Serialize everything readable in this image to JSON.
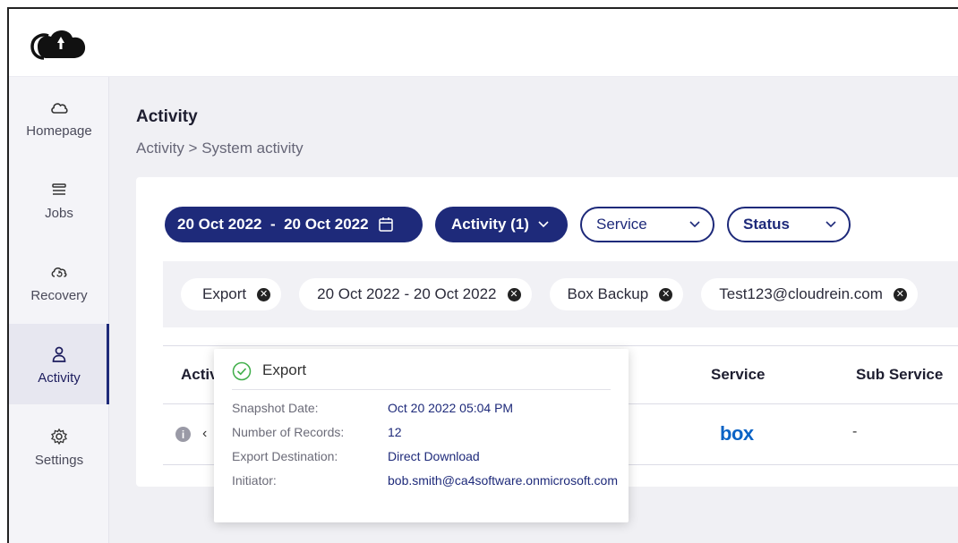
{
  "sidebar": {
    "items": [
      {
        "label": "Homepage",
        "icon": "cloud-icon"
      },
      {
        "label": "Jobs",
        "icon": "list-icon"
      },
      {
        "label": "Recovery",
        "icon": "recovery-icon"
      },
      {
        "label": "Activity",
        "icon": "user-icon"
      },
      {
        "label": "Settings",
        "icon": "gear-icon"
      }
    ],
    "active": "Activity"
  },
  "header": {
    "title": "Activity",
    "breadcrumb": "Activity > System activity"
  },
  "filters": {
    "date_range": "20 Oct 2022  -  20 Oct 2022",
    "activity": "Activity (1)",
    "service": "Service",
    "status": "Status"
  },
  "chips": [
    {
      "label": "Export"
    },
    {
      "label": "20 Oct 2022 - 20 Oct 2022"
    },
    {
      "label": "Box Backup"
    },
    {
      "label": "Test123@cloudrein.com"
    }
  ],
  "table": {
    "columns": {
      "activity": "Activi",
      "service": "Service",
      "sub_service": "Sub Service"
    },
    "rows": [
      {
        "service": "box",
        "sub_service": "-"
      }
    ]
  },
  "tooltip": {
    "title": "Export",
    "fields": [
      {
        "label": "Snapshot Date:",
        "value": "Oct 20 2022 05:04 PM"
      },
      {
        "label": "Number of Records:",
        "value": "12"
      },
      {
        "label": "Export Destination:",
        "value": "Direct Download"
      },
      {
        "label": "Initiator:",
        "value": "bob.smith@ca4software.onmicrosoft.com"
      }
    ]
  },
  "colors": {
    "primary": "#1e2a7a",
    "box_brand": "#0b63c5",
    "success": "#3fae49"
  }
}
